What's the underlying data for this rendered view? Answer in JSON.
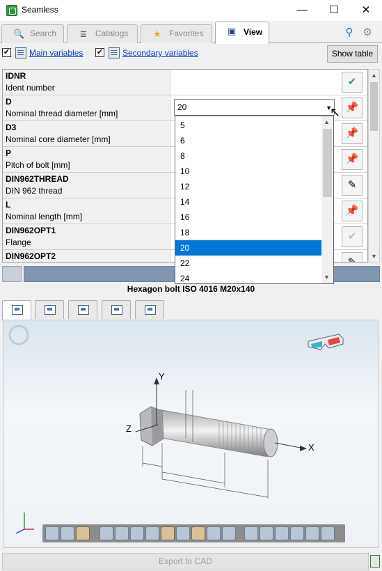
{
  "window": {
    "title": "Seamless",
    "minimize": "—",
    "maximize": "☐",
    "close": "✕"
  },
  "tabs": [
    {
      "label": "Search",
      "icon": "search-icon",
      "glyph": "🔍"
    },
    {
      "label": "Catalogs",
      "icon": "catalogs-icon",
      "glyph": "≣"
    },
    {
      "label": "Favorites",
      "icon": "star-icon",
      "glyph": "★"
    },
    {
      "label": "View",
      "icon": "view-icon",
      "glyph": "▣"
    }
  ],
  "header_icons": {
    "help": "⚲",
    "settings": "⚙"
  },
  "variables_bar": {
    "main_checked": "✔",
    "main_label": "Main variables",
    "secondary_checked": "✔",
    "secondary_label": "Secondary variables",
    "show_table_label": "Show table"
  },
  "variables": [
    {
      "code": "IDNR",
      "description": "Ident number",
      "action": "✔"
    },
    {
      "code": "D",
      "description": "Nominal thread diameter [mm]",
      "action": "📌"
    },
    {
      "code": "D3",
      "description": "Nominal core diameter [mm]",
      "action": "📌"
    },
    {
      "code": "P",
      "description": "Pitch of bolt [mm]",
      "action": "📌"
    },
    {
      "code": "DIN962THREAD",
      "description": "DIN 962 thread",
      "action": "✎"
    },
    {
      "code": "L",
      "description": "Nominal length [mm]",
      "action": "📌"
    },
    {
      "code": "DIN962OPT1",
      "description": "Flange",
      "action": "✔"
    },
    {
      "code": "DIN962OPT2",
      "description": "",
      "action": "✎"
    }
  ],
  "combo": {
    "value": "20",
    "arrow": "▼",
    "cursor": "↖"
  },
  "dropdown": {
    "options": [
      "5",
      "6",
      "8",
      "10",
      "12",
      "14",
      "16",
      "18",
      "20",
      "22",
      "24"
    ],
    "selected": "20"
  },
  "part_title": "Hexagon bolt ISO 4016 M20x140",
  "view_tabs": [
    "3d-view",
    "2d-view",
    "drawing-view",
    "print-view",
    "measure-view"
  ],
  "toolbar_icons": 24,
  "export_label": "Export to CAD"
}
